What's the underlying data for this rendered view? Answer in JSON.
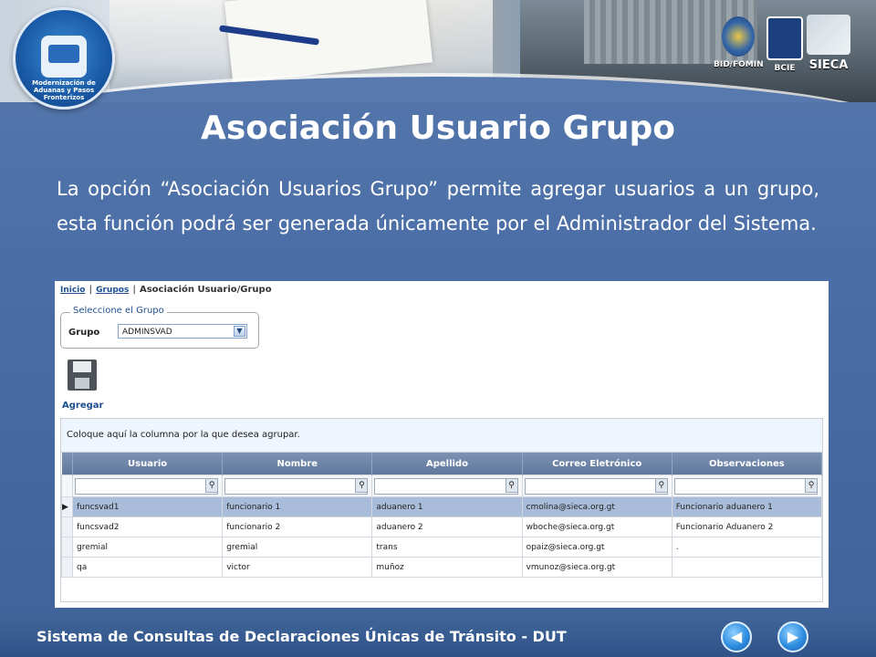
{
  "header": {
    "logo_text": "Modernización de Aduanas y Pasos Fronterizos",
    "partners": [
      "BID/FOMIN",
      "BCIE",
      "SIECA"
    ]
  },
  "slide": {
    "title": "Asociación Usuario Grupo",
    "intro": "La opción “Asociación Usuarios Grupo” permite agregar usuarios a un grupo, esta función podrá ser generada únicamente por el Administrador del Sistema."
  },
  "app": {
    "breadcrumb": {
      "inicio": "Inicio",
      "grupos": "Grupos",
      "current": "Asociación Usuario/Grupo"
    },
    "group_selector": {
      "legend": "Seleccione el Grupo",
      "label": "Grupo",
      "value": "ADMINSVAD"
    },
    "agregar_label": "Agregar",
    "grid": {
      "group_area_text": "Coloque aquí la columna por la que desea agrupar.",
      "columns": [
        "Usuario",
        "Nombre",
        "Apellido",
        "Correo Eletrónico",
        "Observaciones"
      ],
      "rows": [
        [
          "funcsvad1",
          "funcionario 1",
          "aduanero 1",
          "cmolina@sieca.org.gt",
          "Funcionario aduanero 1"
        ],
        [
          "funcsvad2",
          "funcionario 2",
          "aduanero 2",
          "wboche@sieca.org.gt",
          "Funcionario Aduanero 2"
        ],
        [
          "gremial",
          "gremial",
          "trans",
          "opaiz@sieca.org.gt",
          "."
        ],
        [
          "qa",
          "victor",
          "muñoz",
          "vmunoz@sieca.org.gt",
          ""
        ]
      ],
      "selected_row": 0
    }
  },
  "footer": {
    "text": "Sistema de Consultas de Declaraciones Únicas de Tránsito - DUT"
  },
  "icons": {
    "save": "floppy-disk-icon",
    "filter": "magnifier-icon",
    "prev": "arrow-left-icon",
    "next": "arrow-right-icon"
  }
}
